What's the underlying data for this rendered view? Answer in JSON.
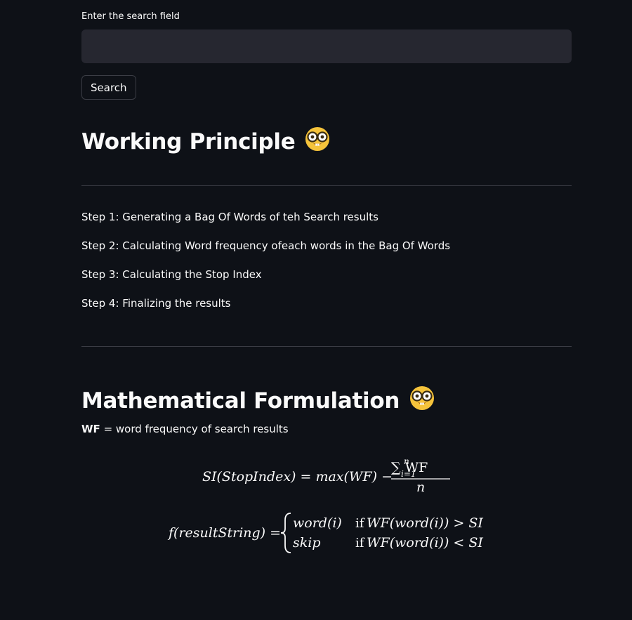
{
  "search": {
    "label": "Enter the search field",
    "value": "",
    "placeholder": "",
    "button_label": "Search"
  },
  "working_principle": {
    "title": "Working Principle",
    "emoji": "nerd-face-icon",
    "steps": [
      "Step 1: Generating a Bag Of Words of teh Search results",
      "Step 2: Calculating Word frequency ofeach words in the Bag Of Words",
      "Step 3: Calculating the Stop Index",
      "Step 4: Finalizing the results"
    ]
  },
  "math": {
    "title": "Mathematical Formulation",
    "emoji": "nerd-face-icon",
    "wf_abbrev": "WF",
    "wf_definition": " = word frequency of search results",
    "formula1": {
      "lhs": "SI(StopIndex) = max(WF) −",
      "numerator": "∑ WF",
      "sum_upper": "n",
      "sum_lower": "i=1",
      "denominator": "n"
    },
    "formula2": {
      "lhs": "f(resultString) =",
      "case1_value": "word(i)",
      "case1_cond_if": "if",
      "case1_cond": "WF(word(i)) > SI",
      "case2_value": "skip",
      "case2_cond_if": "if",
      "case2_cond": "WF(word(i)) < SI"
    }
  },
  "colors": {
    "background": "#0e1117",
    "input_bg": "#262730",
    "text": "#fafafa",
    "divider": "#3a3c44"
  }
}
